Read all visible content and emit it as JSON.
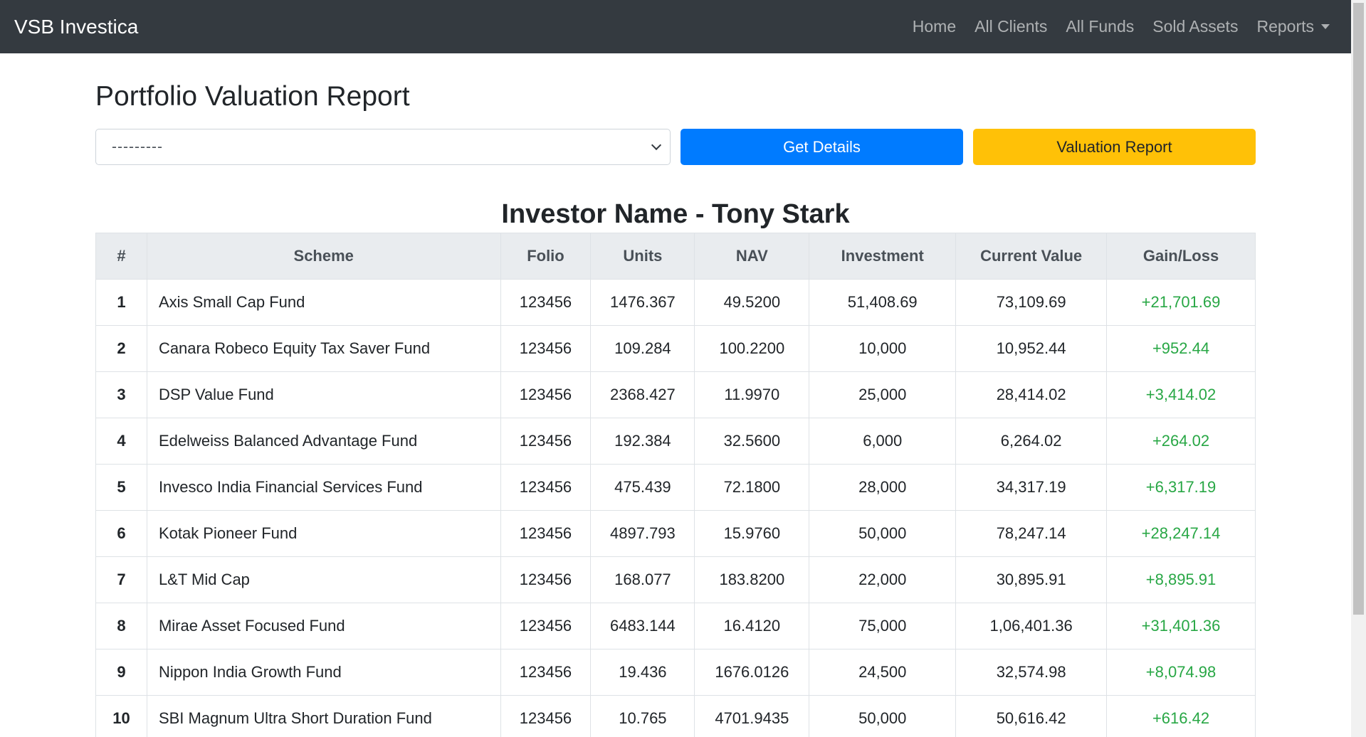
{
  "navbar": {
    "brand": "VSB Investica",
    "links": [
      "Home",
      "All Clients",
      "All Funds",
      "Sold Assets"
    ],
    "reports_label": "Reports"
  },
  "page": {
    "title": "Portfolio Valuation Report",
    "select_value": "---------",
    "get_details_label": "Get Details",
    "valuation_report_label": "Valuation Report",
    "investor_heading": "Investor Name - Tony Stark"
  },
  "table": {
    "headers": [
      "#",
      "Scheme",
      "Folio",
      "Units",
      "NAV",
      "Investment",
      "Current Value",
      "Gain/Loss"
    ],
    "rows": [
      [
        "1",
        "Axis Small Cap Fund",
        "123456",
        "1476.367",
        "49.5200",
        "51,408.69",
        "73,109.69",
        "+21,701.69"
      ],
      [
        "2",
        "Canara Robeco Equity Tax Saver Fund",
        "123456",
        "109.284",
        "100.2200",
        "10,000",
        "10,952.44",
        "+952.44"
      ],
      [
        "3",
        "DSP Value Fund",
        "123456",
        "2368.427",
        "11.9970",
        "25,000",
        "28,414.02",
        "+3,414.02"
      ],
      [
        "4",
        "Edelweiss Balanced Advantage Fund",
        "123456",
        "192.384",
        "32.5600",
        "6,000",
        "6,264.02",
        "+264.02"
      ],
      [
        "5",
        "Invesco India Financial Services Fund",
        "123456",
        "475.439",
        "72.1800",
        "28,000",
        "34,317.19",
        "+6,317.19"
      ],
      [
        "6",
        "Kotak Pioneer Fund",
        "123456",
        "4897.793",
        "15.9760",
        "50,000",
        "78,247.14",
        "+28,247.14"
      ],
      [
        "7",
        "L&T Mid Cap",
        "123456",
        "168.077",
        "183.8200",
        "22,000",
        "30,895.91",
        "+8,895.91"
      ],
      [
        "8",
        "Mirae Asset Focused Fund",
        "123456",
        "6483.144",
        "16.4120",
        "75,000",
        "1,06,401.36",
        "+31,401.36"
      ],
      [
        "9",
        "Nippon India Growth Fund",
        "123456",
        "19.436",
        "1676.0126",
        "24,500",
        "32,574.98",
        "+8,074.98"
      ],
      [
        "10",
        "SBI Magnum Ultra Short Duration Fund",
        "123456",
        "10.765",
        "4701.9435",
        "50,000",
        "50,616.42",
        "+616.42"
      ]
    ]
  },
  "colors": {
    "navbar_bg": "#343a40",
    "primary": "#007bff",
    "warning": "#ffc107",
    "gain": "#28a745"
  }
}
